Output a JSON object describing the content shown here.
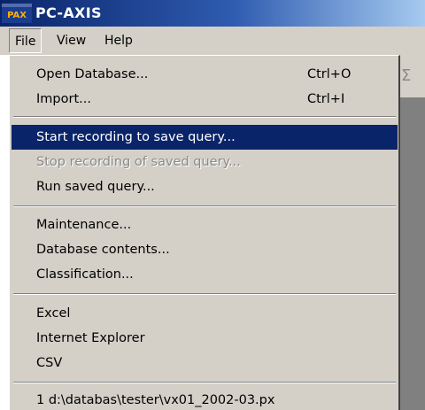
{
  "window": {
    "title": "PC-AXIS",
    "app_icon_text": "PAX",
    "title_bar_color": "#0a246a"
  },
  "menubar": {
    "items": [
      {
        "label": "File",
        "active": true
      },
      {
        "label": "View",
        "active": false
      },
      {
        "label": "Help",
        "active": false
      }
    ]
  },
  "background": {
    "toolbar_icon_glyph": "Σ"
  },
  "file_menu": {
    "highlight_color": "#0a246a",
    "items": [
      {
        "label": "Open Database...",
        "shortcut": "Ctrl+O",
        "state": "normal"
      },
      {
        "label": "Import...",
        "shortcut": "Ctrl+I",
        "state": "normal"
      },
      {
        "label": "Start recording to save query...",
        "shortcut": "",
        "state": "highlighted"
      },
      {
        "label": "Stop recording of saved query...",
        "shortcut": "",
        "state": "disabled"
      },
      {
        "label": "Run saved query...",
        "shortcut": "",
        "state": "normal"
      },
      {
        "label": "Maintenance...",
        "shortcut": "",
        "state": "normal"
      },
      {
        "label": "Database contents...",
        "shortcut": "",
        "state": "normal"
      },
      {
        "label": "Classification...",
        "shortcut": "",
        "state": "normal"
      },
      {
        "label": "Excel",
        "shortcut": "",
        "state": "normal"
      },
      {
        "label": "Internet Explorer",
        "shortcut": "",
        "state": "normal"
      },
      {
        "label": "CSV",
        "shortcut": "",
        "state": "normal"
      },
      {
        "label": "1 d:\\databas\\tester\\vx01_2002-03.px",
        "shortcut": "",
        "state": "normal"
      }
    ]
  }
}
